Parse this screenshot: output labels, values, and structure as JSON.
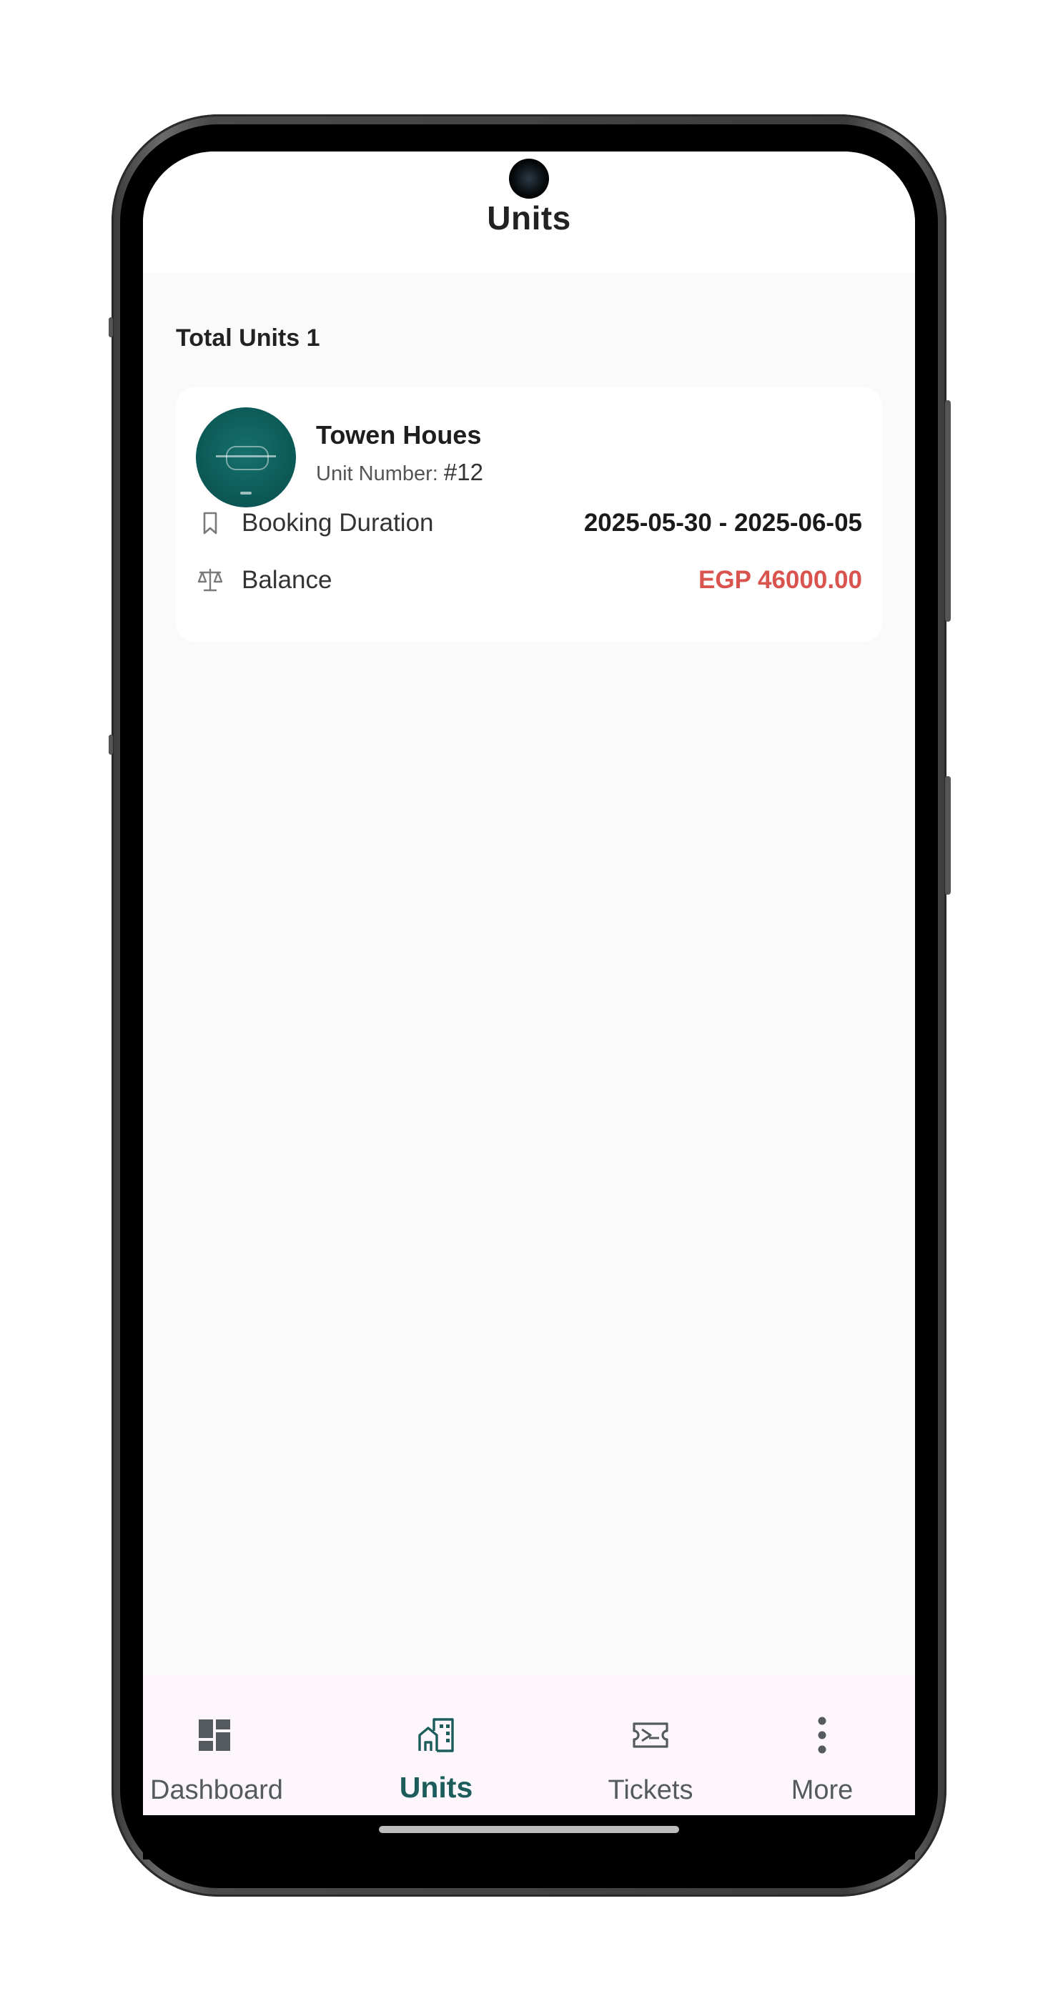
{
  "header": {
    "title": "Units"
  },
  "summary": {
    "total_units_label": "Total Units 1"
  },
  "unit_card": {
    "name": "Towen Houes",
    "unit_number_label": "Unit Number: ",
    "unit_number_value": "#12",
    "booking_duration_label": "Booking Duration",
    "booking_duration_value": "2025-05-30 - 2025-06-05",
    "balance_label": "Balance",
    "balance_value": "EGP 46000.00",
    "balance_color": "#d9534f",
    "avatar_color": "#0c5b59"
  },
  "bottom_nav": {
    "items": [
      {
        "label": "Dashboard",
        "icon": "dashboard-icon",
        "active": false
      },
      {
        "label": "Units",
        "icon": "building-icon",
        "active": true
      },
      {
        "label": "Tickets",
        "icon": "ticket-icon",
        "active": false
      },
      {
        "label": "More",
        "icon": "more-vertical-icon",
        "active": false
      }
    ],
    "active_color": "#1c5c5a",
    "background": "#fdf6fc"
  }
}
